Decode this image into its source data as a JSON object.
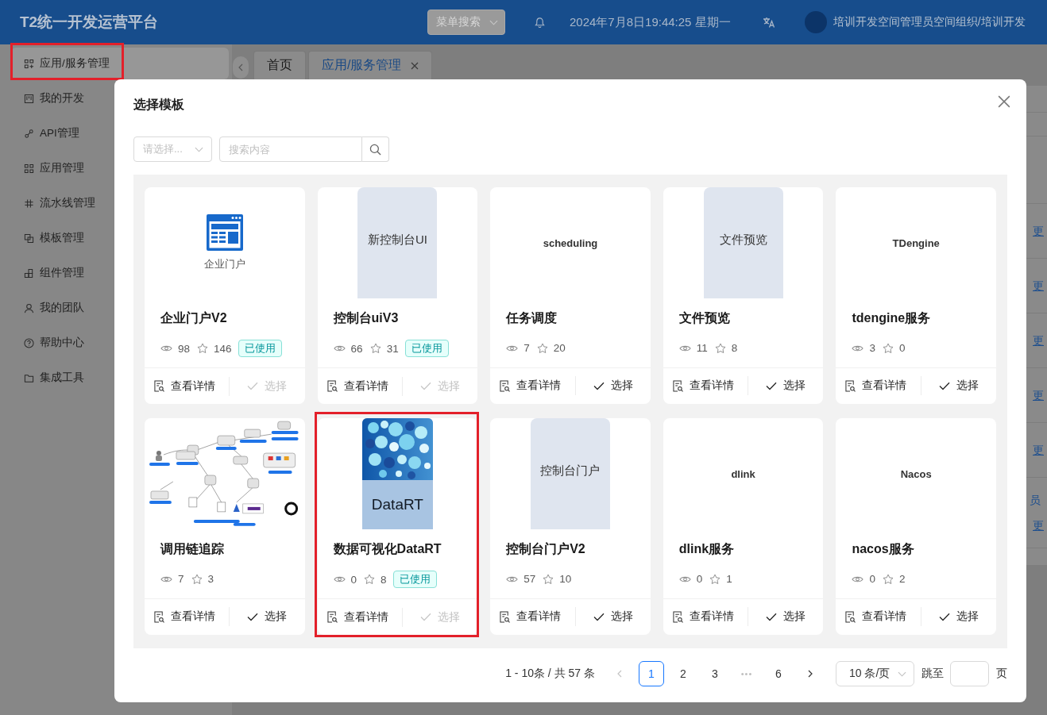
{
  "header": {
    "title": "T2统一开发运营平台",
    "menu_search": {
      "placeholder": "菜单搜索"
    },
    "datetime": "2024年7月8日19:44:25 星期一",
    "user": "培训开发空间管理员空间组织/培训开发"
  },
  "sidebar": {
    "items": [
      {
        "label": "应用/服务管理",
        "selected": true,
        "highlighted": true
      },
      {
        "label": "我的开发",
        "selected": false,
        "highlighted": false
      },
      {
        "label": "API管理",
        "selected": false,
        "highlighted": false
      },
      {
        "label": "应用管理",
        "selected": false,
        "highlighted": false
      },
      {
        "label": "流水线管理",
        "selected": false,
        "highlighted": false
      },
      {
        "label": "模板管理",
        "selected": false,
        "highlighted": false
      },
      {
        "label": "组件管理",
        "selected": false,
        "highlighted": false
      },
      {
        "label": "我的团队",
        "selected": false,
        "highlighted": false
      },
      {
        "label": "帮助中心",
        "selected": false,
        "highlighted": false
      },
      {
        "label": "集成工具",
        "selected": false,
        "highlighted": false
      }
    ]
  },
  "tabs": [
    {
      "label": "首页",
      "selected": false,
      "closable": false
    },
    {
      "label": "应用/服务管理",
      "selected": true,
      "closable": true
    }
  ],
  "page_rows": [
    {
      "link": "更"
    },
    {
      "link": "更"
    },
    {
      "link": "更"
    },
    {
      "link": "更"
    },
    {
      "link": "更"
    },
    {
      "note": "员",
      "link": "更"
    }
  ],
  "dialog": {
    "title": "选择模板",
    "filter": {
      "placeholder": "请选择..."
    },
    "search": {
      "placeholder": "搜索内容"
    },
    "cards": [
      {
        "thumbnail": {
          "kind": "icon",
          "caption": "企业门户"
        },
        "title": "企业门户V2",
        "views": "98",
        "favorites": "146",
        "badge": "已使用",
        "detail_label": "查看详情",
        "select_label": "选择",
        "select_disabled": true,
        "highlighted": false
      },
      {
        "thumbnail": {
          "kind": "poster",
          "caption": "新控制台UI"
        },
        "title": "控制台uiV3",
        "views": "66",
        "favorites": "31",
        "badge": "已使用",
        "detail_label": "查看详情",
        "select_label": "选择",
        "select_disabled": true,
        "highlighted": false
      },
      {
        "thumbnail": {
          "kind": "wordmark",
          "caption": "scheduling"
        },
        "title": "任务调度",
        "views": "7",
        "favorites": "20",
        "detail_label": "查看详情",
        "select_label": "选择",
        "select_disabled": false,
        "highlighted": false
      },
      {
        "thumbnail": {
          "kind": "poster",
          "caption": "文件预览"
        },
        "title": "文件预览",
        "views": "11",
        "favorites": "8",
        "detail_label": "查看详情",
        "select_label": "选择",
        "select_disabled": false,
        "highlighted": false
      },
      {
        "thumbnail": {
          "kind": "wordmark",
          "caption": "TDengine"
        },
        "title": "tdengine服务",
        "views": "3",
        "favorites": "0",
        "detail_label": "查看详情",
        "select_label": "选择",
        "select_disabled": false,
        "highlighted": false
      },
      {
        "thumbnail": {
          "kind": "diagram"
        },
        "title": "调用链追踪",
        "views": "7",
        "favorites": "3",
        "detail_label": "查看详情",
        "select_label": "选择",
        "select_disabled": false,
        "highlighted": false
      },
      {
        "thumbnail": {
          "kind": "cover",
          "caption": "DataRT"
        },
        "title": "数据可视化DataRT",
        "views": "0",
        "favorites": "8",
        "badge": "已使用",
        "detail_label": "查看详情",
        "select_label": "选择",
        "select_disabled": true,
        "highlighted": true
      },
      {
        "thumbnail": {
          "kind": "poster",
          "caption": "控制台门户"
        },
        "title": "控制台门户V2",
        "views": "57",
        "favorites": "10",
        "detail_label": "查看详情",
        "select_label": "选择",
        "select_disabled": false,
        "highlighted": false
      },
      {
        "thumbnail": {
          "kind": "wordmark",
          "caption": "dlink"
        },
        "title": "dlink服务",
        "views": "0",
        "favorites": "1",
        "detail_label": "查看详情",
        "select_label": "选择",
        "select_disabled": false,
        "highlighted": false
      },
      {
        "thumbnail": {
          "kind": "wordmark",
          "caption": "Nacos"
        },
        "title": "nacos服务",
        "views": "0",
        "favorites": "2",
        "detail_label": "查看详情",
        "select_label": "选择",
        "select_disabled": false,
        "highlighted": false
      }
    ],
    "pagination": {
      "summary": "1 - 10条 / 共 57 条",
      "prev_disabled": true,
      "next_disabled": false,
      "pages": [
        {
          "label": "1",
          "kind": "page",
          "selected": true
        },
        {
          "label": "2",
          "kind": "page",
          "selected": false
        },
        {
          "label": "3",
          "kind": "page",
          "selected": false
        },
        {
          "label": "•••",
          "kind": "ellipsis",
          "selected": false
        },
        {
          "label": "6",
          "kind": "page",
          "selected": false
        }
      ],
      "page_size": "10 条/页",
      "jump_label": "跳至",
      "jump_suffix": "页"
    }
  }
}
